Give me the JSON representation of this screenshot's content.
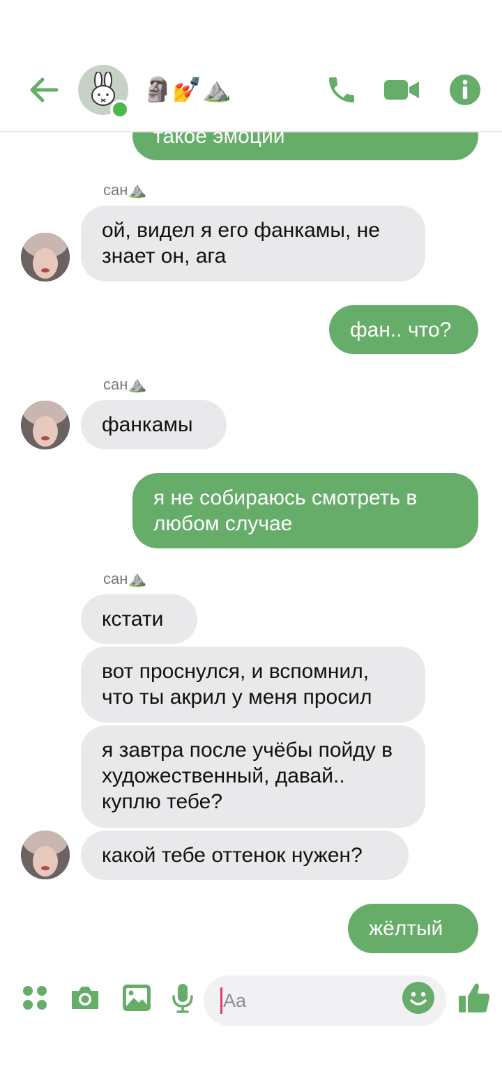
{
  "header": {
    "title": "🗿💅⛰️",
    "accent_color": "#67ad6a",
    "icons": [
      "back-arrow-icon",
      "group-avatar-bunny",
      "phone-icon",
      "video-camera-icon",
      "info-icon"
    ]
  },
  "messages": {
    "m0_partial": "такое эмоции",
    "sender_1": "сан⛰️",
    "m1": "ой, видел я его фанкамы, не знает он, ага",
    "m2": "фан.. что?",
    "sender_2": "сан⛰️",
    "m3": "фанкамы",
    "m4": "я не собираюсь смотреть в любом случае",
    "sender_3": "сан⛰️",
    "m5": "кстати",
    "m6": "вот проснулся, и вспомнил, что ты акрил у меня просил",
    "m7": "я завтра после учёбы пойду в художественный, давай.. куплю тебе?",
    "m8": "какой тебе оттенок нужен?",
    "m9": "жёлтый"
  },
  "composer": {
    "placeholder": "Aa",
    "icons": [
      "grid-icon",
      "camera-icon",
      "gallery-icon",
      "microphone-icon",
      "emoji-icon",
      "thumbs-up-icon"
    ]
  },
  "colors": {
    "outgoing_bubble": "#67ad6a",
    "incoming_bubble": "#e9e9eb",
    "online": "#4cb84c"
  }
}
